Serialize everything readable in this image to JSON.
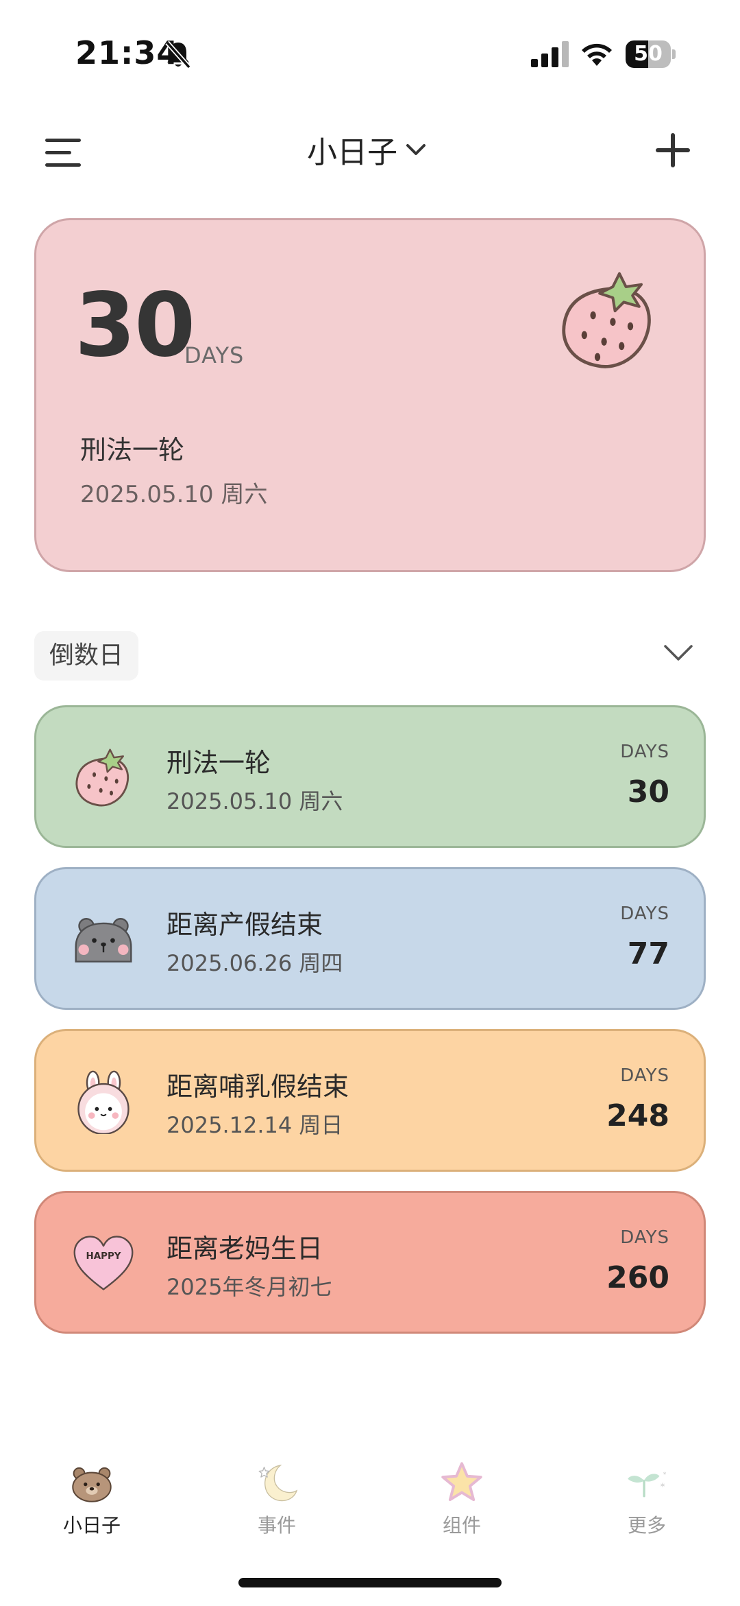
{
  "status_bar": {
    "time": "21:34",
    "battery_level": "50",
    "battery_fraction": 0.5
  },
  "nav": {
    "title": "小日子",
    "menu_icon": "hamburger-menu-icon",
    "dropdown_icon": "chevron-down-icon",
    "add_icon": "plus-icon"
  },
  "hero": {
    "days": "30",
    "days_unit": "DAYS",
    "title": "刑法一轮",
    "date": "2025.05.10 周六",
    "icon": "strawberry-icon",
    "color": "#f3cfd1"
  },
  "section": {
    "label": "倒数日",
    "toggle_icon": "chevron-down-icon"
  },
  "events": [
    {
      "title": "刑法一轮",
      "date": "2025.05.10 周六",
      "unit": "DAYS",
      "days": "30",
      "icon": "strawberry-icon",
      "bg": "#c3dbc0",
      "border": "#9bb697"
    },
    {
      "title": "距离产假结束",
      "date": "2025.06.26 周四",
      "unit": "DAYS",
      "days": "77",
      "icon": "gray-bear-icon",
      "bg": "#c7d8e9",
      "border": "#9eb0c4"
    },
    {
      "title": "距离哺乳假结束",
      "date": "2025.12.14 周日",
      "unit": "DAYS",
      "days": "248",
      "icon": "bunny-icon",
      "bg": "#fdd4a3",
      "border": "#dbb07a"
    },
    {
      "title": "距离老妈生日",
      "date": "2025年冬月初七",
      "unit": "DAYS",
      "days": "260",
      "icon": "happy-heart-icon",
      "bg": "#f6ab9c",
      "border": "#d08878"
    }
  ],
  "heart_text": "HAPPY",
  "tabs": [
    {
      "label": "小日子",
      "icon": "bear-icon",
      "active": true
    },
    {
      "label": "事件",
      "icon": "moon-icon",
      "active": false
    },
    {
      "label": "组件",
      "icon": "star-icon",
      "active": false
    },
    {
      "label": "更多",
      "icon": "sprout-icon",
      "active": false
    }
  ],
  "colors": {
    "tab_active": "#222222",
    "tab_inactive": "#9a9a9a"
  }
}
